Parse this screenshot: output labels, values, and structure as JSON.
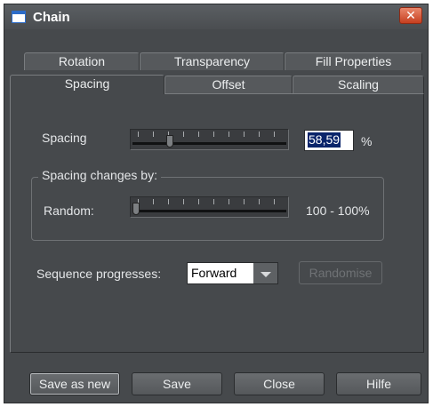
{
  "window": {
    "title": "Chain",
    "close_glyph": "✕"
  },
  "tabs": {
    "row1": [
      "Rotation",
      "Transparency",
      "Fill Properties"
    ],
    "row2": [
      "Spacing",
      "Offset",
      "Scaling"
    ],
    "active": "Spacing"
  },
  "spacing": {
    "label": "Spacing",
    "value": "58,59",
    "unit": "%",
    "slider_level": 0.23
  },
  "group": {
    "title": "Spacing changes by:",
    "random_label": "Random:",
    "random_value": "100 - 100%",
    "slider_level": 0.0
  },
  "sequence": {
    "label": "Sequence progresses:",
    "selected": "Forward",
    "randomise_label": "Randomise"
  },
  "buttons": {
    "save_as_new": "Save as new",
    "save": "Save",
    "close": "Close",
    "help": "Hilfe"
  },
  "icons": {
    "window": "window-icon",
    "close": "close-icon",
    "dropdown": "chevron-down-icon"
  },
  "colors": {
    "dialog_bg": "#46494c",
    "close_button": "#c63f20",
    "selection": "#0a246a"
  }
}
